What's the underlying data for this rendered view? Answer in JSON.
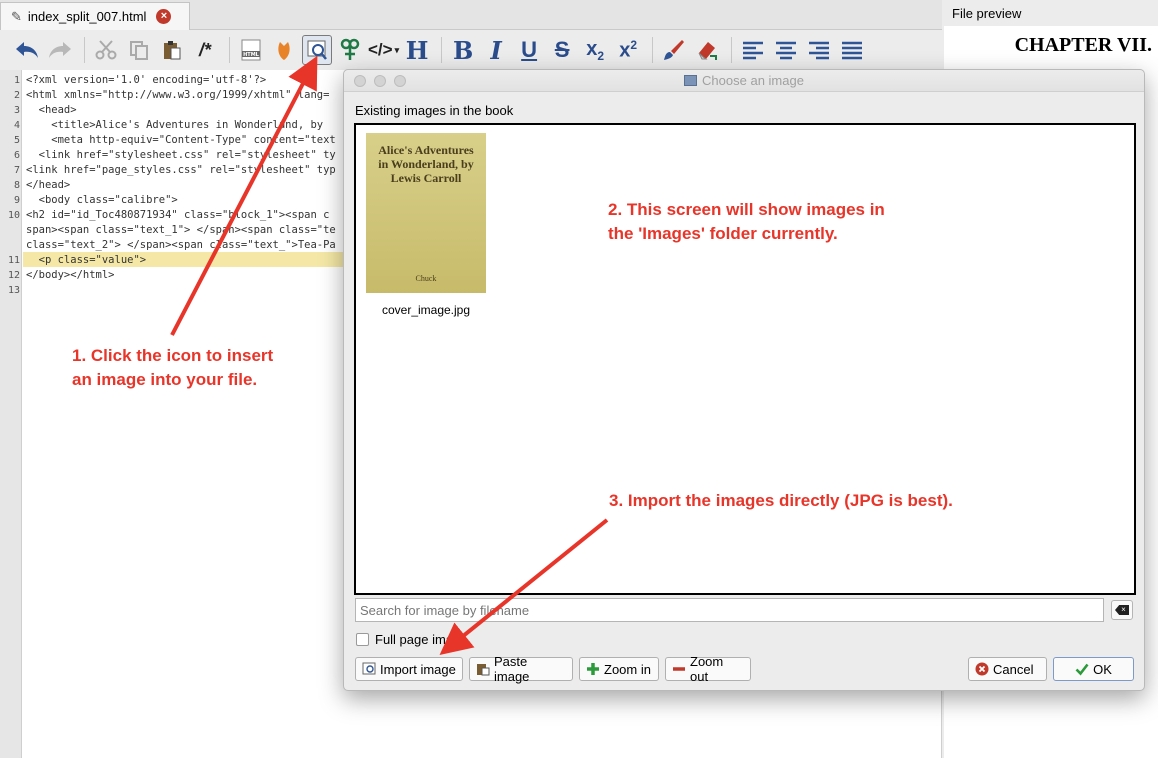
{
  "tab": {
    "label": "index_split_007.html"
  },
  "preview": {
    "header": "File preview",
    "chapter": "CHAPTER VII."
  },
  "editor": {
    "line_numbers": [
      "1",
      "2",
      "3",
      "4",
      "5",
      "6",
      "7",
      "8",
      "9",
      "10",
      "",
      "",
      "11",
      "12",
      "13"
    ],
    "lines": [
      "<?xml version='1.0' encoding='utf-8'?>",
      "<html xmlns=\"http://www.w3.org/1999/xhtml\" lang=",
      "  <head>",
      "    <title>Alice's Adventures in Wonderland, by",
      "    <meta http-equiv=\"Content-Type\" content=\"text",
      "  <link href=\"stylesheet.css\" rel=\"stylesheet\" ty",
      "<link href=\"page_styles.css\" rel=\"stylesheet\" typ",
      "</head>",
      "  <body class=\"calibre\">",
      "<h2 id=\"id_Toc480871934\" class=\"block_1\"><span c",
      "span><span class=\"text_1\"> </span><span class=\"te",
      "class=\"text_2\"> </span><span class=\"text_\">Tea-Pa",
      "  <p class=\"value\">",
      "</body></html>",
      ""
    ]
  },
  "dialog": {
    "title": "Choose an image",
    "existing_label": "Existing images in the book",
    "images": [
      {
        "title": "Alice's Adventures in Wonderland, by Lewis Carroll",
        "author": "Chuck",
        "filename": "cover_image.jpg"
      }
    ],
    "search_placeholder": "Search for image by filename",
    "full_page_label": "Full page image",
    "buttons": {
      "import": "Import image",
      "paste": "Paste image",
      "zoom_in": "Zoom in",
      "zoom_out": "Zoom out",
      "cancel": "Cancel",
      "ok": "OK"
    }
  },
  "annotations": {
    "one": [
      "1. Click the icon to insert",
      "an image into your file."
    ],
    "two": [
      "2. This screen will show images in",
      "the 'Images' folder currently."
    ],
    "three": "3. Import the images directly (JPG is best).",
    "color": "#e8352a"
  }
}
